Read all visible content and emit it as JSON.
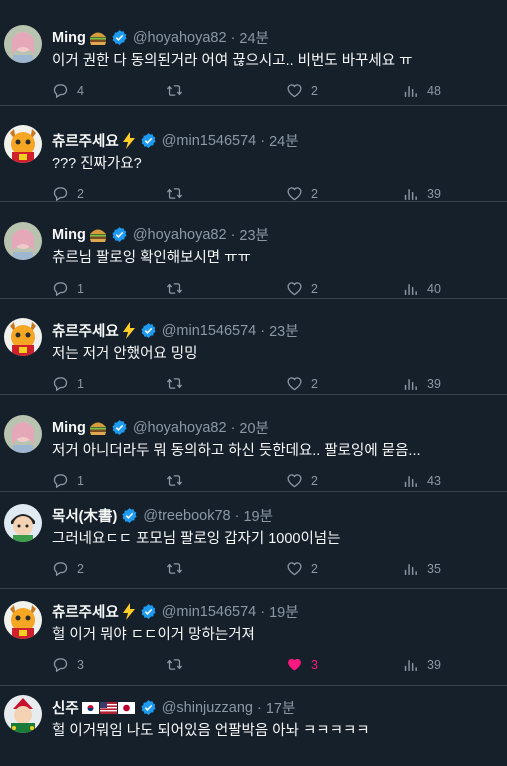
{
  "colors": {
    "background": "#15202b",
    "text": "#f7f9f9",
    "secondary": "#8b98a5",
    "verified": "#1d9bf0",
    "like_active": "#f91880",
    "divider": "#38444d"
  },
  "tweets": [
    {
      "name": "Ming",
      "emoji": "burger-icon",
      "handle": "@hoyahoya82",
      "time": "24분",
      "text": "이거 권한 다 동의된거라 어여 끊으시고.. 비번도 바꾸세요 ㅠ",
      "replies": "4",
      "retweets": "",
      "likes": "2",
      "views": "48",
      "liked": false
    },
    {
      "name": "츄르주세요",
      "emoji": "lightning-icon",
      "handle": "@min1546574",
      "time": "24분",
      "text": "??? 진짜가요?",
      "replies": "2",
      "retweets": "",
      "likes": "2",
      "views": "39",
      "liked": false
    },
    {
      "name": "Ming",
      "emoji": "burger-icon",
      "handle": "@hoyahoya82",
      "time": "23분",
      "text": "츄르님 팔로잉 확인해보시면 ㅠㅠ",
      "replies": "1",
      "retweets": "",
      "likes": "2",
      "views": "40",
      "liked": false
    },
    {
      "name": "츄르주세요",
      "emoji": "lightning-icon",
      "handle": "@min1546574",
      "time": "23분",
      "text": "저는 저거 안했어요 밍밍",
      "replies": "1",
      "retweets": "",
      "likes": "2",
      "views": "39",
      "liked": false
    },
    {
      "name": "Ming",
      "emoji": "burger-icon",
      "handle": "@hoyahoya82",
      "time": "20분",
      "text": "저거 아니더라두 뭐 동의하고 하신 듯한데요.. 팔로잉에 묻음...",
      "replies": "1",
      "retweets": "",
      "likes": "2",
      "views": "43",
      "liked": false
    },
    {
      "name": "목서(木書)",
      "emoji": "",
      "handle": "@treebook78",
      "time": "19분",
      "text": "그러네요ㄷㄷ 포모님 팔로잉 갑자기 1000이넘는",
      "replies": "2",
      "retweets": "",
      "likes": "2",
      "views": "35",
      "liked": false
    },
    {
      "name": "츄르주세요",
      "emoji": "lightning-icon",
      "handle": "@min1546574",
      "time": "19분",
      "text": "헐 이거 뭐야 ㄷㄷ이거 망하는거져",
      "replies": "3",
      "retweets": "",
      "likes": "3",
      "views": "39",
      "liked": true
    },
    {
      "name": "신주",
      "emoji": "flags-kr-us-jp-icon",
      "handle": "@shinjuzzang",
      "time": "17분",
      "text": "헐 이거뭐임 나도 되어있음 언팔박음 아놔 ㅋㅋㅋㅋㅋ",
      "replies": "",
      "retweets": "",
      "likes": "",
      "views": "",
      "liked": false
    }
  ]
}
